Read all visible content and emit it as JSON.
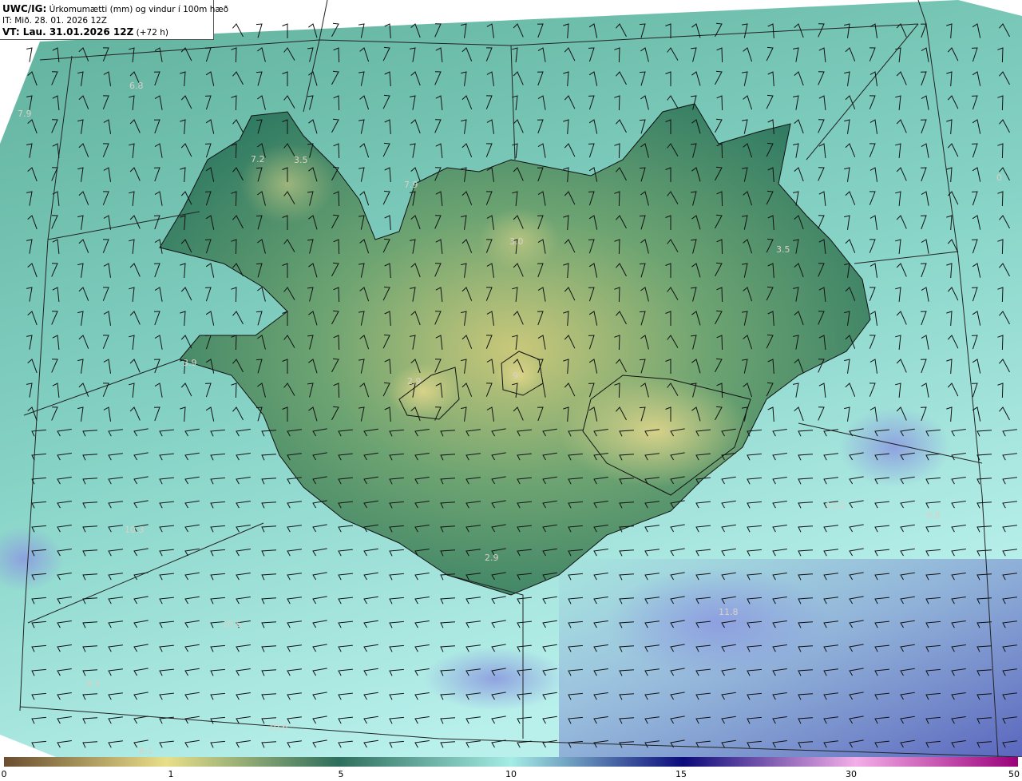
{
  "header": {
    "line1_bold": "UWC/IG:",
    "line1_text": " Úrkomumætti (mm) og vindur í 100m hæð",
    "line2": "IT: Mið. 28. 01. 2026 12Z",
    "line3_bold": "VT: Lau. 31.01.2026 12Z",
    "line3_text": " (+72 h)"
  },
  "map_labels": [
    {
      "text": "6.8",
      "name": "value-label-nw-sea"
    },
    {
      "text": "7.9",
      "name": "value-label-west-edge"
    },
    {
      "text": "7.2",
      "name": "value-label-westfjords-1"
    },
    {
      "text": "3.5",
      "name": "value-label-westfjords-2"
    },
    {
      "text": "7.9",
      "name": "value-label-north-fjord"
    },
    {
      "text": "3.0",
      "name": "value-label-north-central"
    },
    {
      "text": "3.5",
      "name": "value-label-east"
    },
    {
      "text": "3.9",
      "name": "value-label-snaefellsnes"
    },
    {
      "text": "2.9",
      "name": "value-label-langjokull"
    },
    {
      "text": "9",
      "name": "value-label-hofsjokull"
    },
    {
      "text": "2.9",
      "name": "value-label-south"
    },
    {
      "text": "10.3",
      "name": "value-label-sw-sea"
    },
    {
      "text": "11.8",
      "name": "value-label-se-sea"
    },
    {
      "text": "9.8",
      "name": "value-label-east-sea"
    },
    {
      "text": "11.8",
      "name": "value-label-south-sea"
    },
    {
      "text": "9.7",
      "name": "value-label-sw-far"
    },
    {
      "text": "10.6",
      "name": "value-label-bottom"
    },
    {
      "text": "8.1",
      "name": "value-label-bottom-left"
    },
    {
      "text": "10.6",
      "name": "value-label-bottom-2"
    },
    {
      "text": "0",
      "name": "value-label-right-edge"
    }
  ],
  "colorbar": {
    "ticks": [
      "0",
      "1",
      "5",
      "10",
      "15",
      "30",
      "50"
    ],
    "colors": [
      "#7a5a3a",
      "#e8e08a",
      "#2e6e5c",
      "#9fe6df",
      "#0b0b7a",
      "#f0a8e8",
      "#9a007a"
    ]
  }
}
